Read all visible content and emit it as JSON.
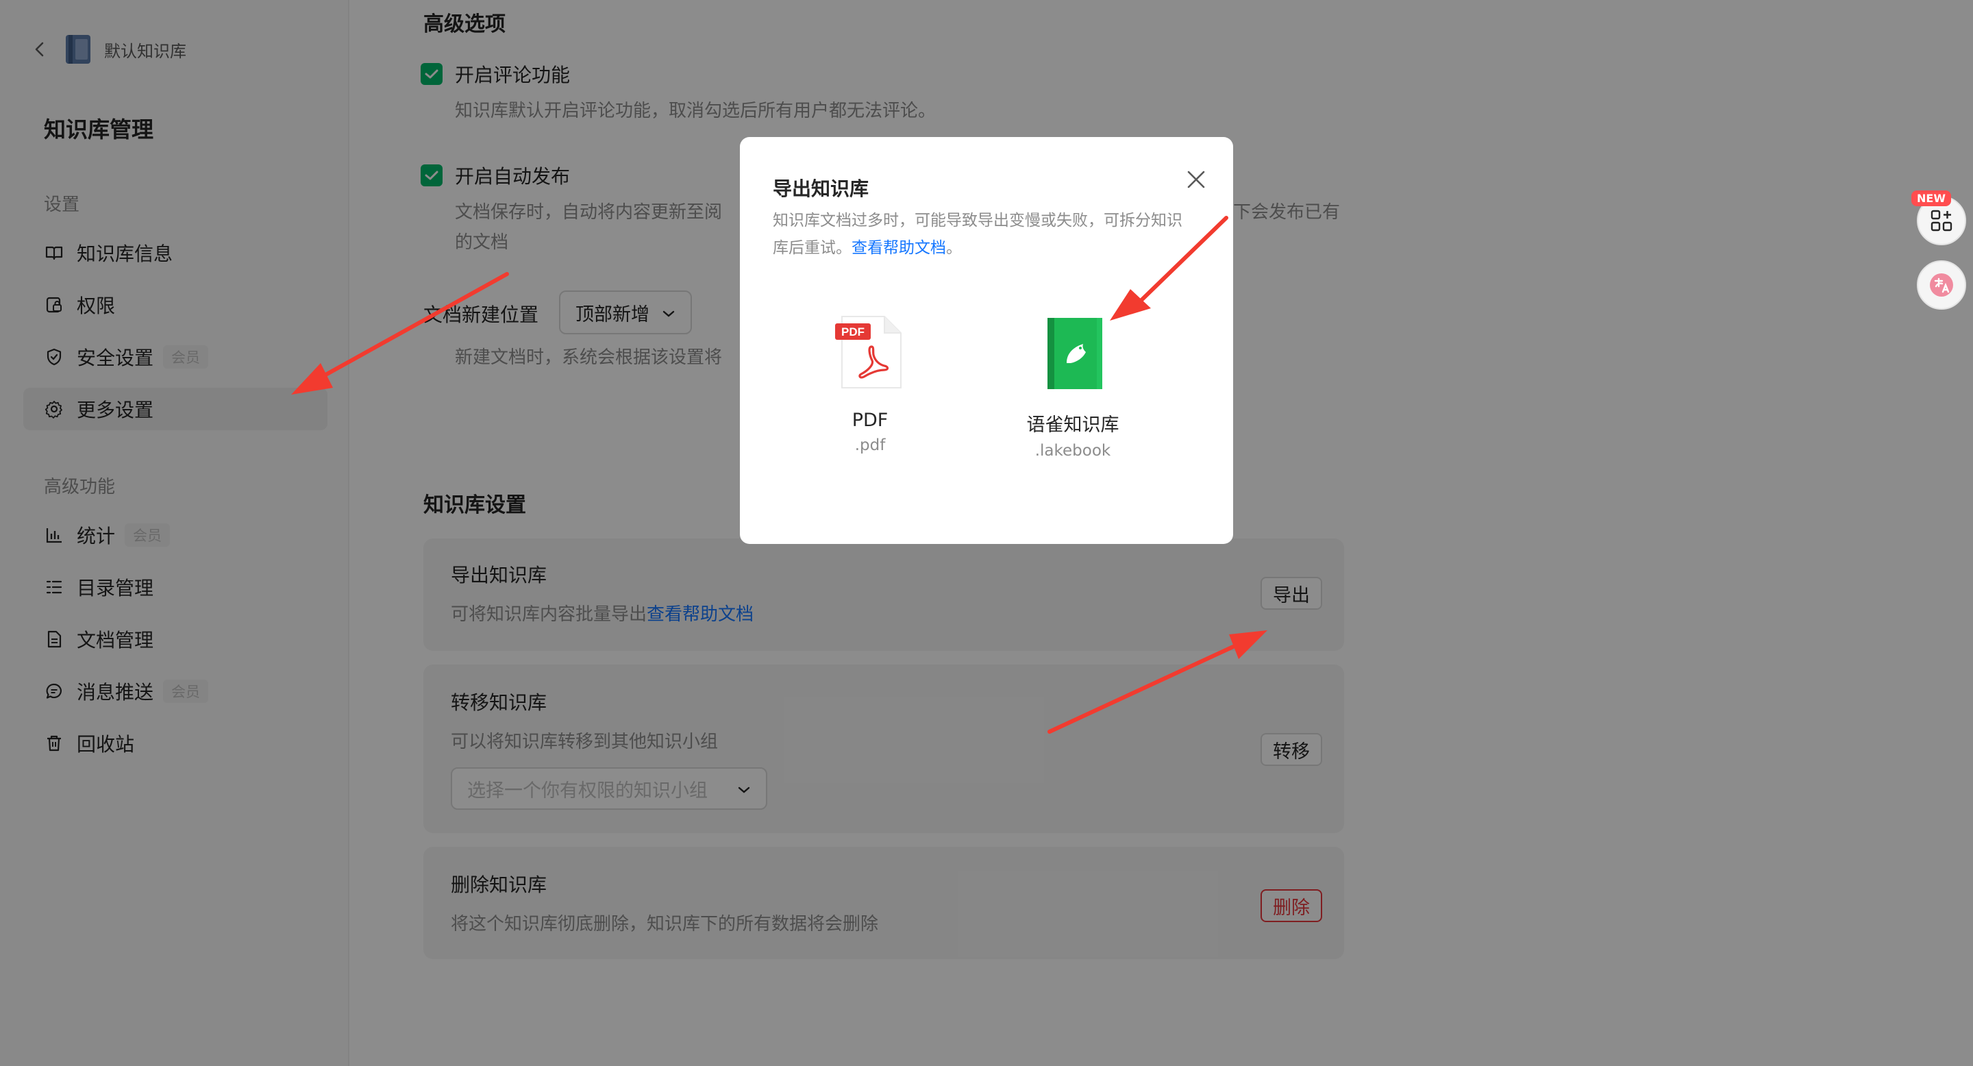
{
  "sidebar": {
    "back_title": "默认知识库",
    "title": "知识库管理",
    "group_settings": "设置",
    "group_advanced": "高级功能",
    "items": [
      {
        "label": "知识库信息"
      },
      {
        "label": "权限"
      },
      {
        "label": "安全设置",
        "badge": "会员"
      },
      {
        "label": "更多设置"
      },
      {
        "label": "统计",
        "badge": "会员"
      },
      {
        "label": "目录管理"
      },
      {
        "label": "文档管理"
      },
      {
        "label": "消息推送",
        "badge": "会员"
      },
      {
        "label": "回收站"
      }
    ]
  },
  "advanced": {
    "title": "高级选项",
    "comment_label": "开启评论功能",
    "comment_desc": "知识库默认开启评论功能，取消勾选后所有用户都无法评论。",
    "autopub_label": "开启自动发布",
    "autopub_desc_left": "文档保存时，自动将内容更新至阅",
    "autopub_desc_right": "下会发布已有",
    "autopub_desc_line2": "的文档",
    "position_label": "文档新建位置",
    "position_value": "顶部新增",
    "position_desc": "新建文档时，系统会根据该设置将"
  },
  "kb_settings": {
    "title": "知识库设置",
    "export": {
      "title": "导出知识库",
      "desc": "可将知识库内容批量导出",
      "link": "查看帮助文档",
      "button": "导出"
    },
    "transfer": {
      "title": "转移知识库",
      "desc": "可以将知识库转移到其他知识小组",
      "placeholder": "选择一个你有权限的知识小组",
      "button": "转移"
    },
    "delete": {
      "title": "删除知识库",
      "desc": "将这个知识库彻底删除，知识库下的所有数据将会删除",
      "button": "删除"
    }
  },
  "float": {
    "new_badge": "NEW"
  },
  "modal": {
    "title": "导出知识库",
    "desc_line1": "知识库文档过多时，可能导致导出变慢或失败，可拆分知识",
    "desc_line2": "库后重试。",
    "link": "查看帮助文档",
    "link_suffix": "。",
    "options": [
      {
        "name": "PDF",
        "ext": ".pdf",
        "badge": "PDF"
      },
      {
        "name": "语雀知识库",
        "ext": ".lakebook"
      }
    ]
  },
  "colors": {
    "accent": "#00b96b",
    "link": "#1677ff",
    "danger": "#e8383d",
    "arrow": "#f23b2f"
  }
}
